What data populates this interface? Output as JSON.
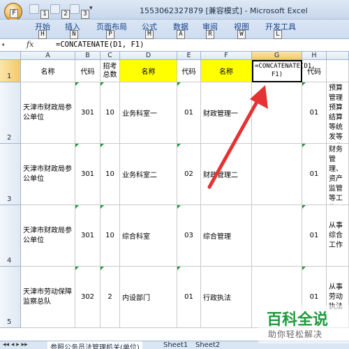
{
  "window": {
    "title": "1553062327879  [兼容模式] - Microsoft Excel",
    "office_key": "F",
    "qat_keys": [
      "1",
      "2",
      "3"
    ]
  },
  "ribbon": {
    "tabs": [
      {
        "label": "开始",
        "key": "H"
      },
      {
        "label": "插入",
        "key": "N"
      },
      {
        "label": "页面布局",
        "key": "P"
      },
      {
        "label": "公式",
        "key": "M"
      },
      {
        "label": "数据",
        "key": "A"
      },
      {
        "label": "审阅",
        "key": "R"
      },
      {
        "label": "视图",
        "key": "W"
      },
      {
        "label": "开发工具",
        "key": "L"
      }
    ]
  },
  "formula_bar": {
    "fx": "fx",
    "formula": "=CONCATENATE(D1, F1)"
  },
  "grid": {
    "columns": [
      "A",
      "B",
      "C",
      "D",
      "E",
      "F",
      "G",
      "H"
    ],
    "rows": [
      "1",
      "2",
      "3",
      "4",
      "5"
    ],
    "header_row": {
      "a": "名称",
      "b": "代码",
      "c": "招考总数",
      "d": "名称",
      "e": "代码",
      "f": "名称",
      "g": "=CONCATENATE(D1, F1)",
      "h": "代码"
    },
    "data": [
      {
        "a": "天津市财政局参公单位",
        "b": "301",
        "c": "10",
        "d": "业务科室一",
        "e": "01",
        "f": "财政管理一",
        "h": "01",
        "i": "从事预算管理预算结算等统发等工作"
      },
      {
        "a": "天津市财政局参公单位",
        "b": "301",
        "c": "10",
        "d": "业务科室二",
        "e": "02",
        "f": "财政管理二",
        "h": "01",
        "i": "从事财务管理、资产监管等工作"
      },
      {
        "a": "天津市财政局参公单位",
        "b": "301",
        "c": "10",
        "d": "综合科室",
        "e": "03",
        "f": "综合管理",
        "h": "01",
        "i": "从事综合工作"
      },
      {
        "a": "天津市劳动保障监察总队",
        "b": "302",
        "c": "2",
        "d": "内设部门",
        "e": "01",
        "f": "行政执法",
        "h": "01",
        "i": "从事劳动执法"
      }
    ]
  },
  "sheets": [
    "参照公务员法管理机关(单位)",
    "Sheet1",
    "Sheet2"
  ],
  "watermark": {
    "main": "百科全说",
    "sub": "助你轻松解决"
  },
  "colors": {
    "highlight": "#ffff00",
    "arrow": "#e53232",
    "brand": "#1f9a3d"
  }
}
